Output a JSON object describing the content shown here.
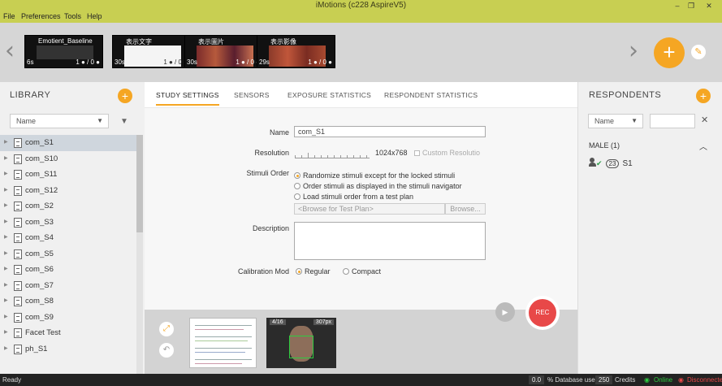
{
  "window": {
    "title": "iMotions (c228 AspireV5)",
    "minimize": "–",
    "restore": "❐",
    "close": "✕"
  },
  "menu": [
    "File",
    "Preferences",
    "Tools",
    "Help"
  ],
  "stimuli": [
    {
      "label": "Emotient_Baseline",
      "duration": "6s",
      "count": "1 ● / 0 ●"
    },
    {
      "label": "表示文字",
      "duration": "30s",
      "count": "1 ● / 0 ●"
    },
    {
      "label": "表示圖片",
      "duration": "30s",
      "count": "1 ● / 0 ●"
    },
    {
      "label": "表示影像",
      "duration": "29s",
      "count": "1 ● / 0 ●"
    }
  ],
  "library": {
    "heading": "LIBRARY",
    "sort_label": "Name",
    "items": [
      "com_S1",
      "com_S10",
      "com_S11",
      "com_S12",
      "com_S2",
      "com_S3",
      "com_S4",
      "com_S5",
      "com_S6",
      "com_S7",
      "com_S8",
      "com_S9",
      "Facet Test",
      "ph_S1"
    ]
  },
  "tabs": [
    "STUDY SETTINGS",
    "SENSORS",
    "EXPOSURE STATISTICS",
    "RESPONDENT STATISTICS"
  ],
  "form": {
    "name_label": "Name",
    "name_value": "com_S1",
    "resolution_label": "Resolution",
    "resolution_value": "1024x768",
    "custom_resolution": "Custom Resolutio",
    "stimuli_order_label": "Stimuli Order",
    "order_options": [
      "Randomize stimuli except for the locked stimuli",
      "Order stimuli as displayed in the stimuli navigator",
      "Load stimuli order from a test plan"
    ],
    "browse_placeholder": "<Browse for Test Plan>",
    "browse_button": "Browse...",
    "description_label": "Description",
    "calibration_label": "Calibration Mod",
    "calibration_options": [
      "Regular",
      "Compact"
    ]
  },
  "recorder": {
    "rec_label": "REC",
    "cam_counter": "4/16",
    "cam_res": "307px"
  },
  "respondents": {
    "heading": "RESPONDENTS",
    "sort_label": "Name",
    "group": "MALE (1)",
    "items": [
      {
        "badge": "23",
        "name": "S1"
      }
    ]
  },
  "status": {
    "ready": "Ready",
    "db_value": "0.0",
    "db_label": "% Database used",
    "credits_value": "250",
    "credits_label": "Credits",
    "online": "Online",
    "disconnected": "Disconnected"
  },
  "colors": {
    "accent": "#f5a623",
    "titlebar": "#c8cf52",
    "rec": "#e84848"
  }
}
